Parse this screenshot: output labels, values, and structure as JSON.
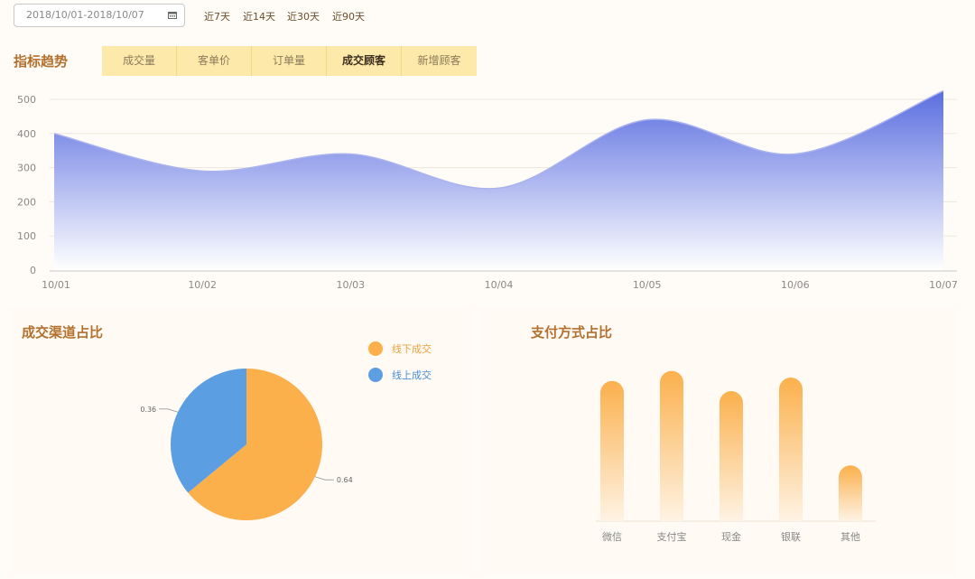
{
  "toolbar": {
    "date_range": "2018/10/01-2018/10/07",
    "quick_ranges": [
      "近7天",
      "近14天",
      "近30天",
      "近90天"
    ]
  },
  "trend": {
    "title": "指标趋势",
    "tabs": [
      "成交量",
      "客单价",
      "订单量",
      "成交顾客",
      "新增顾客"
    ],
    "active_tab": 3
  },
  "channel": {
    "title": "成交渠道占比"
  },
  "payment": {
    "title": "支付方式占比"
  },
  "chart_data": [
    {
      "type": "area",
      "title": "",
      "x": [
        "10/01",
        "10/02",
        "10/03",
        "10/04",
        "10/05",
        "10/06",
        "10/07"
      ],
      "series": [
        {
          "values": [
            400,
            290,
            340,
            240,
            440,
            340,
            525
          ]
        }
      ],
      "ylim": [
        0,
        500
      ],
      "yticks": [
        0,
        100,
        200,
        300,
        400,
        500
      ],
      "grid": true,
      "colors": {
        "top": "#5b6ee0",
        "bottom": "#ffffff"
      }
    },
    {
      "type": "pie",
      "title": "",
      "labels": [
        "线下成交",
        "线上成交"
      ],
      "values": [
        0.64,
        0.36
      ],
      "colors": [
        "#fbb04c",
        "#5b9ee2"
      ],
      "legend": "top-right"
    },
    {
      "type": "bar",
      "title": "",
      "categories": [
        "微信",
        "支付宝",
        "现金",
        "银联",
        "其他"
      ],
      "values": [
        83,
        89,
        77,
        85,
        33
      ],
      "ylim": [
        0,
        100
      ],
      "colors": {
        "top": "#fbb04c",
        "bottom": "#fef3e4"
      }
    }
  ]
}
